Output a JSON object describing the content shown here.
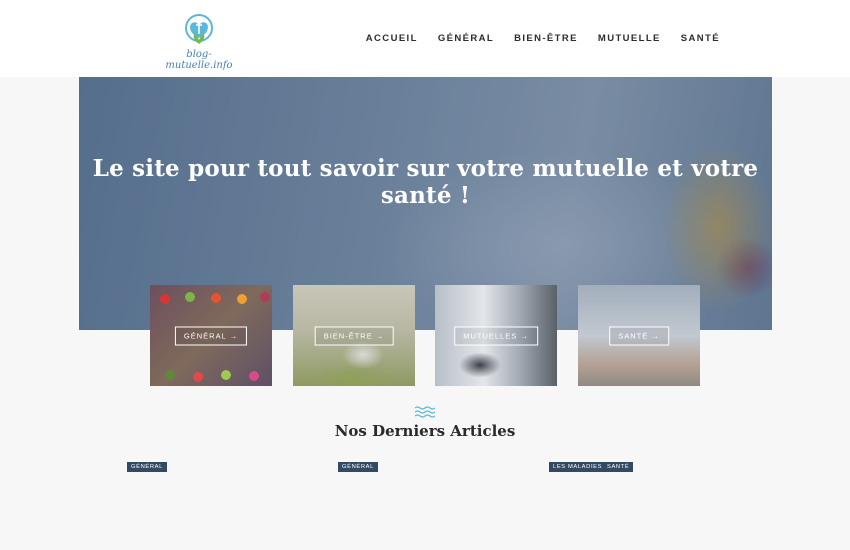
{
  "header": {
    "logo_text": "blog-mutuelle.info",
    "nav": [
      "ACCUEIL",
      "GÉNÉRAL",
      "BIEN-ÊTRE",
      "MUTUELLE",
      "SANTÉ"
    ]
  },
  "hero": {
    "title": "Le site pour tout savoir sur votre mutuelle et votre santé !"
  },
  "categories": [
    {
      "label": "GÉNÉRAL →"
    },
    {
      "label": "BIEN-ÊTRE →"
    },
    {
      "label": "MUTUELLES →"
    },
    {
      "label": "SANTÉ →"
    }
  ],
  "latest": {
    "title": "Nos Derniers Articles",
    "tags": [
      "GÉNÉRAL",
      "GÉNÉRAL",
      "LES MALADIES",
      "SANTÉ"
    ]
  },
  "colors": {
    "accent": "#324a63",
    "wave_icon": "#5bb8d8",
    "logo_text": "#4a7fb0"
  },
  "icons": [
    "logo-mark-icon",
    "waves-icon"
  ]
}
